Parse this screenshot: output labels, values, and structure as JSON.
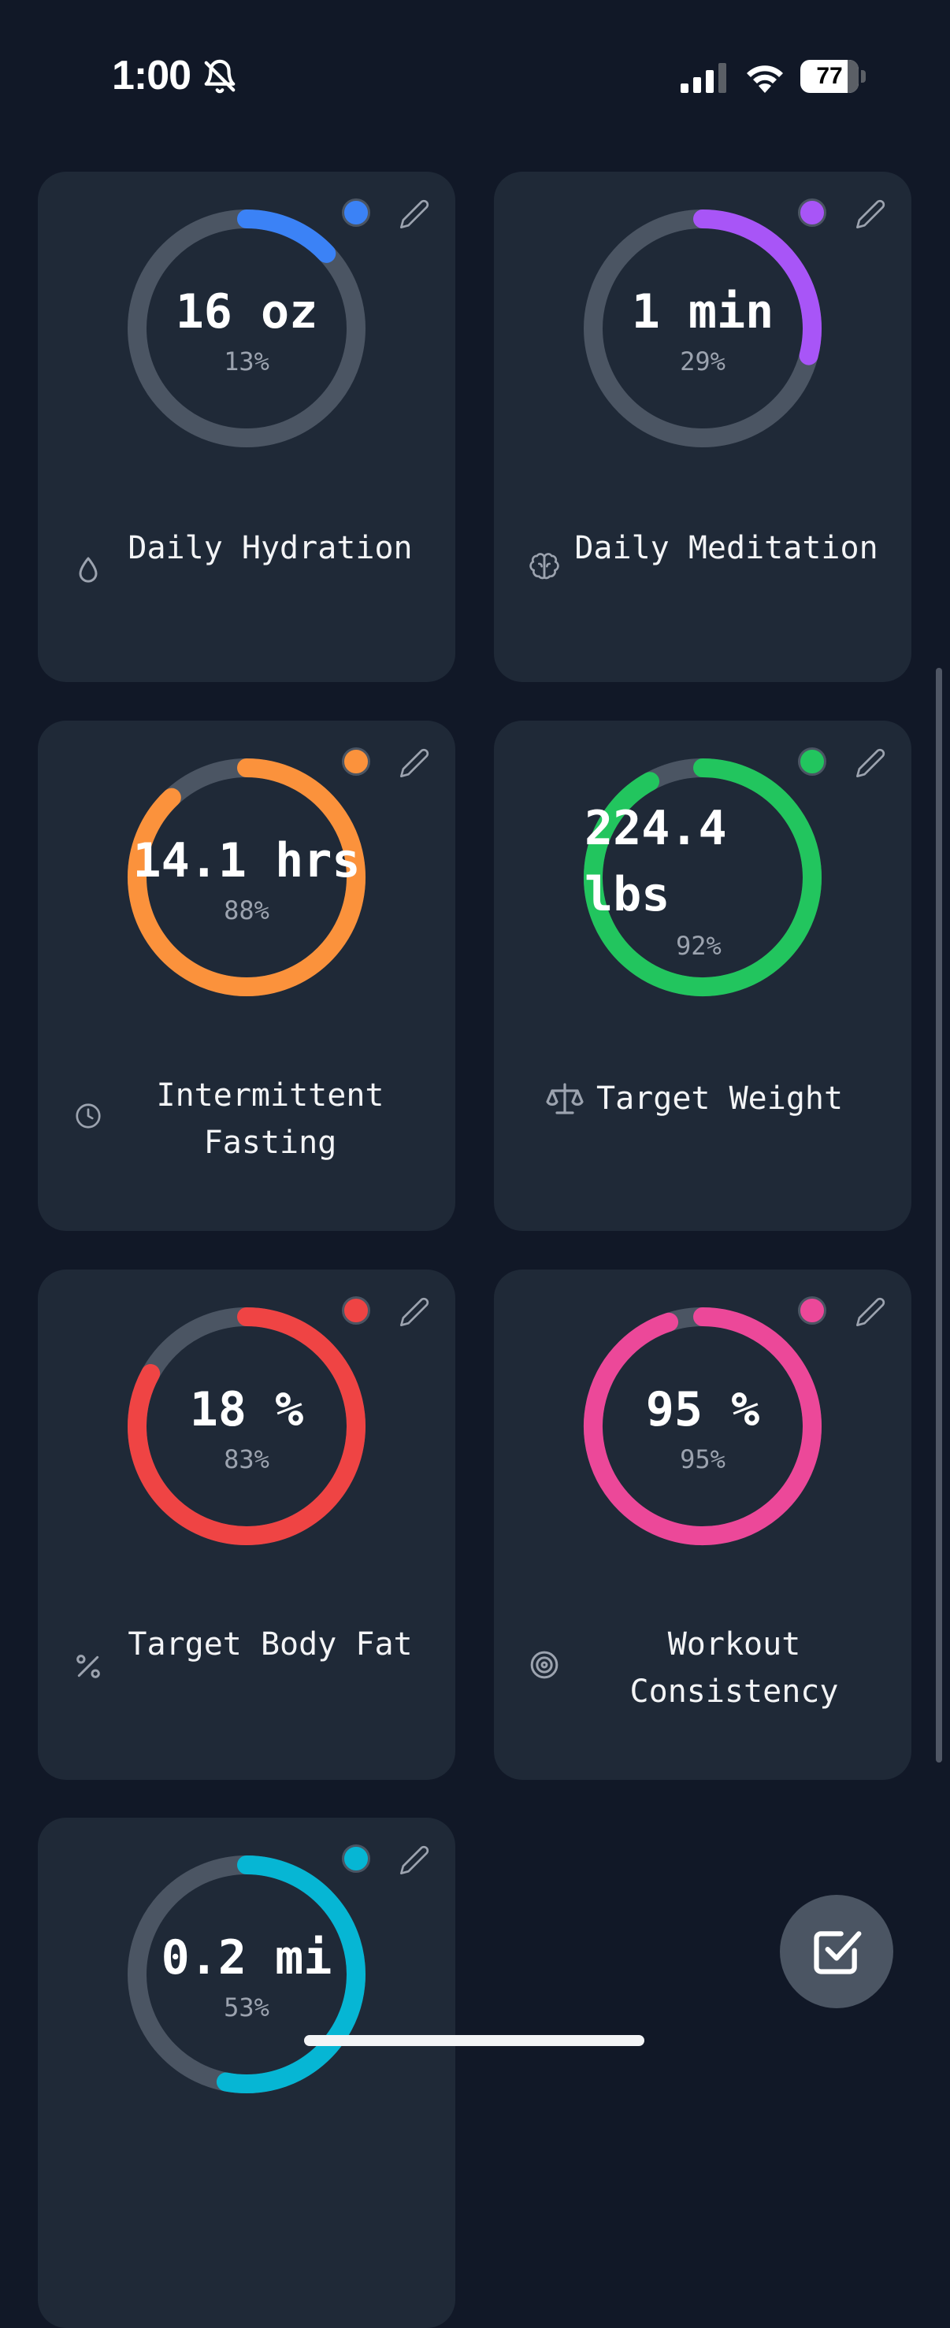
{
  "status_bar": {
    "time": "1:00",
    "battery": "77",
    "icons": [
      "bell-slash-icon",
      "cellular-signal-icon",
      "wifi-icon",
      "battery-icon"
    ]
  },
  "colors": {
    "background": "#111827",
    "card": "#1f2937",
    "track": "#4b5563",
    "hydration": "#3b82f6",
    "meditation": "#a855f7",
    "fasting": "#fb923c",
    "weight": "#22c55e",
    "body_fat": "#ef4444",
    "workout": "#ec4899",
    "distance": "#06b6d4"
  },
  "goals": [
    {
      "title": "Daily Hydration",
      "value": "16 oz",
      "percent": "13%",
      "progress": 0.13,
      "color": "#3b82f6",
      "icon": "water-drop-icon"
    },
    {
      "title": "Daily Meditation",
      "value": "1 min",
      "percent": "29%",
      "progress": 0.29,
      "color": "#a855f7",
      "icon": "brain-icon"
    },
    {
      "title": "Intermittent Fasting",
      "value": "14.1 hrs",
      "percent": "88%",
      "progress": 0.88,
      "color": "#fb923c",
      "icon": "clock-icon"
    },
    {
      "title": "Target Weight",
      "value": "224.4 lbs",
      "percent": "92%",
      "progress": 0.92,
      "color": "#22c55e",
      "icon": "scale-icon"
    },
    {
      "title": "Target Body Fat",
      "value": "18 %",
      "percent": "83%",
      "progress": 0.83,
      "color": "#ef4444",
      "icon": "percent-icon"
    },
    {
      "title": "Workout Consistency",
      "value": "95 %",
      "percent": "95%",
      "progress": 0.95,
      "color": "#ec4899",
      "icon": "target-icon"
    },
    {
      "value": "0.2 mi",
      "percent": "53%",
      "progress": 0.53,
      "color": "#06b6d4"
    }
  ],
  "fab": {
    "icon": "check-square-icon"
  }
}
